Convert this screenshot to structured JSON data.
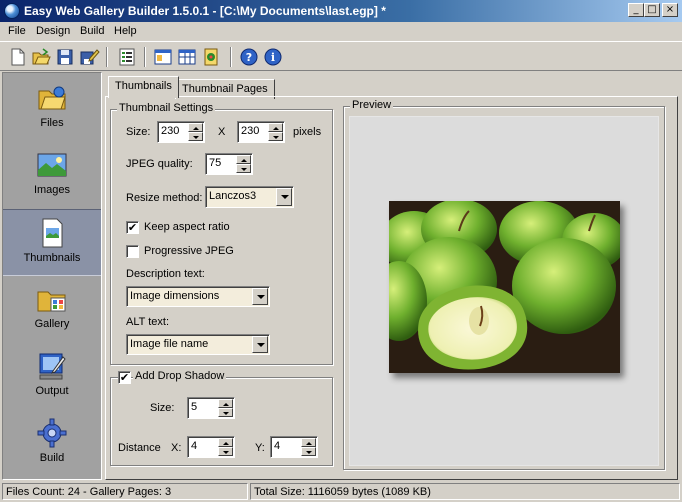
{
  "window": {
    "title": "Easy Web Gallery Builder 1.5.0.1 - [C:\\My Documents\\last.egp] *"
  },
  "window_controls": {
    "minimize": "_",
    "maximize": "□",
    "close": "×"
  },
  "menu": [
    "File",
    "Design",
    "Build",
    "Help"
  ],
  "toolbar": {
    "buttons": [
      "new-document-icon",
      "open-folder-icon",
      "save-disk-icon",
      "save-as-icon",
      "properties-list-icon",
      "web-page-icon",
      "table-layout-icon",
      "build-gallery-icon",
      "help-icon",
      "about-icon"
    ]
  },
  "sidebar": {
    "items": [
      {
        "label": "Files",
        "icon": "folder-icon"
      },
      {
        "label": "Images",
        "icon": "landscape-image-icon"
      },
      {
        "label": "Thumbnails",
        "icon": "thumbnail-document-icon",
        "active": true
      },
      {
        "label": "Gallery",
        "icon": "gallery-folder-icon"
      },
      {
        "label": "Output",
        "icon": "output-monitor-icon"
      },
      {
        "label": "Build",
        "icon": "gear-icon"
      }
    ]
  },
  "tabs": [
    {
      "label": "Thumbnails",
      "active": true
    },
    {
      "label": "Thumbnail Pages",
      "active": false
    }
  ],
  "thumbnail_settings": {
    "title": "Thumbnail Settings",
    "size_label": "Size:",
    "width": "230",
    "times": "X",
    "height": "230",
    "unit": "pixels",
    "jpeg_quality_label": "JPEG quality:",
    "jpeg_quality": "75",
    "resize_method_label": "Resize method:",
    "resize_method": "Lanczos3",
    "keep_aspect_label": "Keep aspect ratio",
    "keep_aspect_checked": true,
    "progressive_label": "Progressive JPEG",
    "progressive_checked": false,
    "description_label": "Description text:",
    "description_value": "Image dimensions",
    "alt_label": "ALT text:",
    "alt_value": "Image file name"
  },
  "drop_shadow": {
    "title": "Add Drop Shadow",
    "checked": true,
    "size_label": "Size:",
    "size": "5",
    "distance_label": "Distance",
    "x_label": "X:",
    "x": "4",
    "y_label": "Y:",
    "y": "4"
  },
  "preview": {
    "title": "Preview"
  },
  "status": {
    "left": "Files Count: 24 - Gallery Pages: 3",
    "right": "Total Size: 1116059 bytes (1089 KB)"
  },
  "check_mark": "✔"
}
